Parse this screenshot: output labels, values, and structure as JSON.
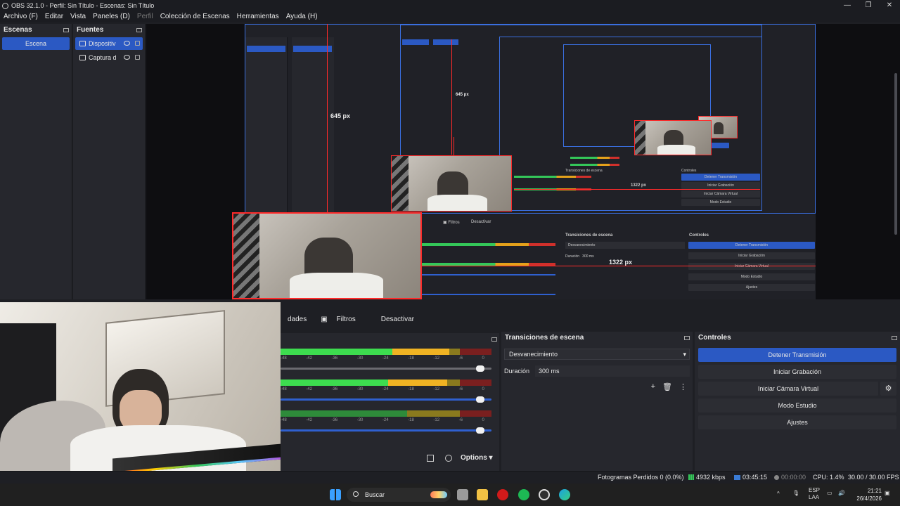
{
  "window": {
    "title": "OBS 32.1.0 - Perfil: Sin Título - Escenas: Sin Título",
    "controls": [
      "—",
      "❐",
      "✕"
    ]
  },
  "menu": {
    "items": [
      "Archivo (F)",
      "Editar",
      "Vista",
      "Paneles (D)",
      "Perfil",
      "Colección de Escenas",
      "Herramientas",
      "Ayuda (H)"
    ]
  },
  "scenes": {
    "title": "Escenas",
    "items": [
      "Escena"
    ]
  },
  "sources": {
    "title": "Fuentes",
    "items": [
      "Dispositiv",
      "Captura d"
    ]
  },
  "preview": {
    "height_label": "645 px",
    "width_label": "1322 px",
    "nested_height_label": "645 px",
    "nested_width_label": "1322 px"
  },
  "source_toolbar": {
    "properties_fragment": "dades",
    "filters": "Filtros",
    "deactivate": "Desactivar"
  },
  "mixer": {
    "ticks": [
      "-48",
      "-42",
      "-36",
      "-30",
      "-24",
      "-18",
      "-12",
      "-6",
      "0"
    ],
    "options_label": "Options",
    "levels": [
      {
        "green": 0.53,
        "yellow": 0.8
      },
      {
        "green": 0.51,
        "yellow": 0.79
      },
      {
        "green": 0.0,
        "yellow": 0.0
      }
    ],
    "volumes": [
      1.0,
      1.0,
      1.0
    ]
  },
  "transitions": {
    "title": "Transiciones de escena",
    "selected": "Desvanecimiento",
    "duration_label": "Duración",
    "duration_value": "300 ms"
  },
  "controls": {
    "title": "Controles",
    "stop_stream": "Detener Transmisión",
    "start_recording": "Iniciar Grabación",
    "start_virtual_cam": "Iniciar Cámara Virtual",
    "studio_mode": "Modo Estudio",
    "settings": "Ajustes"
  },
  "status": {
    "dropped_frames": "Fotogramas Perdidos 0 (0.0%)",
    "bitrate": "4932 kbps",
    "stream_time": "03:45:15",
    "rec_time": "00:00:00",
    "cpu": "CPU: 1.4%",
    "fps": "30.00 / 30.00 FPS"
  },
  "taskbar": {
    "search_placeholder": "Buscar",
    "lang_top": "ESP",
    "lang_bottom": "LAA",
    "time": "21:21",
    "date": "26/4/2026"
  },
  "colors": {
    "accent": "#2b59c3",
    "guide": "#ff2a2a",
    "bg": "#1e1f24"
  }
}
